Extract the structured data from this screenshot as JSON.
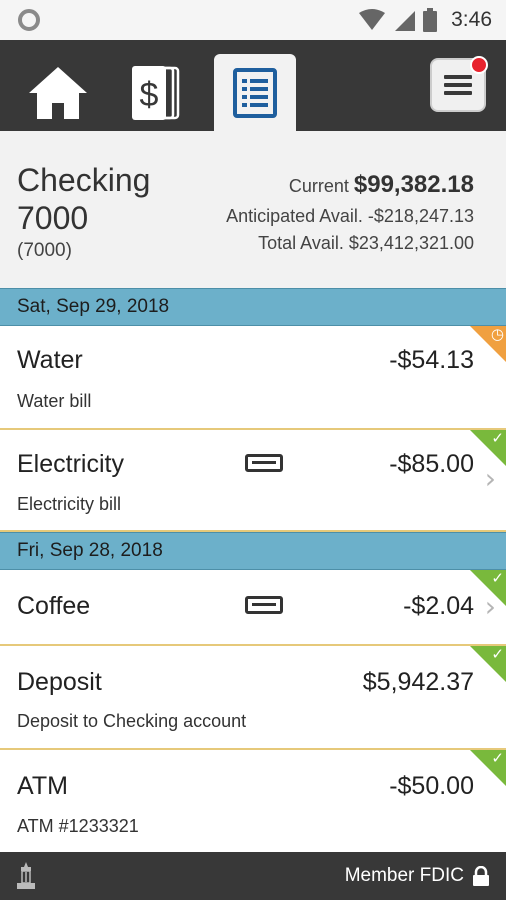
{
  "status_bar": {
    "time": "3:46"
  },
  "nav": {
    "tabs": [
      {
        "icon": "home-icon"
      },
      {
        "icon": "dollar-bills-icon"
      },
      {
        "icon": "register-icon",
        "active": true
      }
    ],
    "menu_icon": "hamburger-menu-icon",
    "menu_has_notification": true
  },
  "account": {
    "name": "Checking 7000",
    "number": "(7000)",
    "current_label": "Current",
    "current_amount": "$99,382.18",
    "anticipated_label": "Anticipated Avail.",
    "anticipated_amount": "-$218,247.13",
    "total_label": "Total Avail.",
    "total_amount": "$23,412,321.00"
  },
  "groups": [
    {
      "date": "Sat, Sep 29, 2018",
      "transactions": [
        {
          "name": "Water",
          "desc": "Water bill",
          "amount": "-$54.13",
          "status": "pending"
        },
        {
          "name": "Electricity",
          "desc": "Electricity bill",
          "amount": "-$85.00",
          "status": "cleared",
          "card": true,
          "chevron": true
        }
      ]
    },
    {
      "date": "Fri, Sep 28, 2018",
      "transactions": [
        {
          "name": "Coffee",
          "desc": "",
          "amount": "-$2.04",
          "status": "cleared",
          "card": true,
          "chevron": true
        },
        {
          "name": "Deposit",
          "desc": "Deposit to Checking account",
          "amount": "$5,942.37",
          "status": "cleared"
        },
        {
          "name": "ATM",
          "desc": "ATM #1233321",
          "amount": "-$50.00",
          "status": "cleared"
        }
      ]
    }
  ],
  "footer": {
    "text": "Member FDIC"
  },
  "colors": {
    "nav_bg": "#383838",
    "date_bar": "#6cb0ca",
    "cleared": "#79b93c",
    "pending": "#f0a040",
    "accent": "#1f5f9e"
  }
}
